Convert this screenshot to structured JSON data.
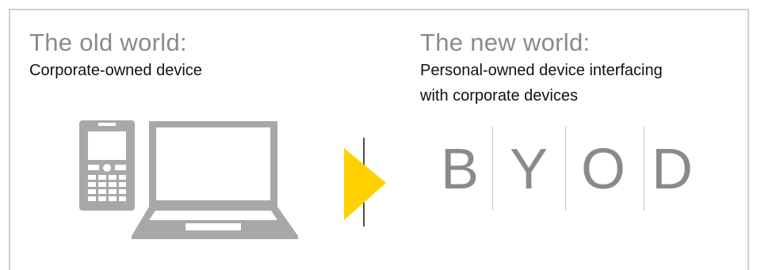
{
  "old_world": {
    "heading": "The old world:",
    "subtitle": "Corporate-owned device",
    "icons": [
      "mobile-phone-icon",
      "laptop-icon"
    ]
  },
  "transition": {
    "icon": "arrow-right-icon",
    "color": "#FFD100"
  },
  "new_world": {
    "heading": "The new world:",
    "subtitle_line1": "Personal-owned device interfacing",
    "subtitle_line2": "with corporate devices",
    "letters": [
      "B",
      "Y",
      "O",
      "D"
    ]
  },
  "colors": {
    "heading": "#8a8a8a",
    "device_gray": "#a8a8a8",
    "border": "#cfcfcf",
    "accent_yellow": "#FFD100"
  }
}
